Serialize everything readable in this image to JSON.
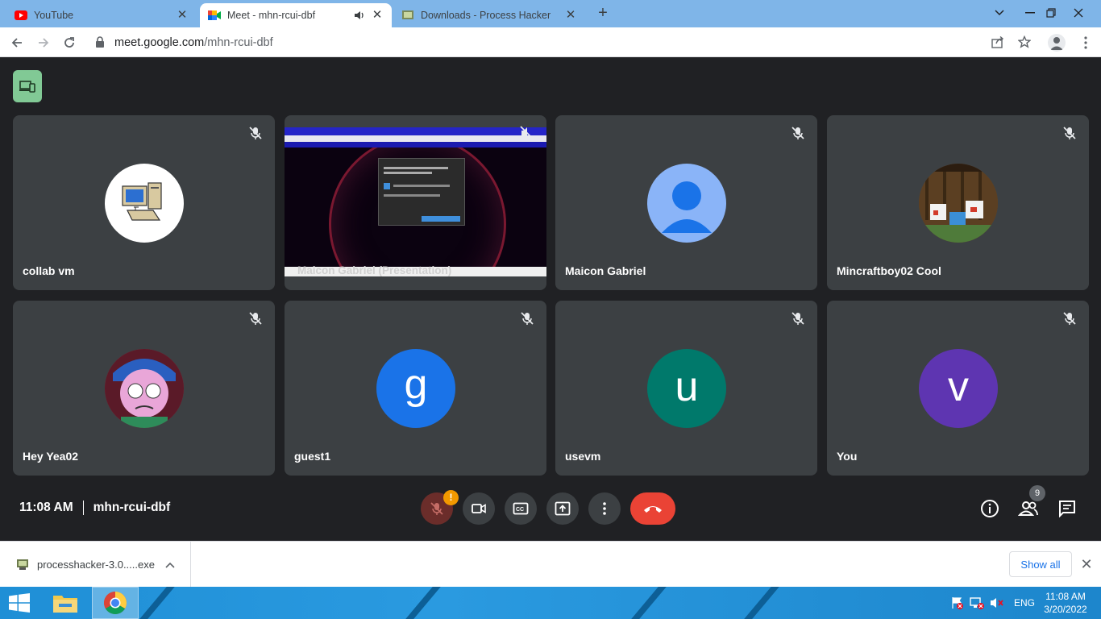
{
  "browser": {
    "tabs": [
      {
        "title": "YouTube",
        "active": false
      },
      {
        "title": "Meet - mhn-rcui-dbf",
        "active": true
      },
      {
        "title": "Downloads - Process Hacker",
        "active": false
      }
    ],
    "address": {
      "domain": "meet.google.com",
      "path": "/mhn-rcui-dbf"
    }
  },
  "meet": {
    "participants": [
      {
        "name": "collab vm",
        "avatar": "computer-avatar",
        "muted": true
      },
      {
        "name": "Maicon Gabriel (Presentation)",
        "avatar": "screen-share",
        "muted": true
      },
      {
        "name": "Maicon Gabriel",
        "avatar": "default-person",
        "color": "#8ab4f8",
        "muted": true
      },
      {
        "name": "Mincraftboy02 Cool",
        "avatar": "minecraft-photo",
        "muted": true
      },
      {
        "name": "Hey Yea02",
        "avatar": "cartoon-photo",
        "muted": true
      },
      {
        "name": "guest1",
        "avatar": "letter",
        "letter": "g",
        "color": "#1a73e8",
        "muted": true
      },
      {
        "name": "usevm",
        "avatar": "letter",
        "letter": "u",
        "color": "#00796b",
        "muted": true
      },
      {
        "name": "You",
        "avatar": "letter",
        "letter": "v",
        "color": "#5e35b1",
        "muted": true
      }
    ],
    "time": "11:08 AM",
    "meeting_code": "mhn-rcui-dbf",
    "mic_warning": "!",
    "people_count": "9"
  },
  "downloads": {
    "file": "processhacker-3.0.....exe",
    "show_all": "Show all"
  },
  "taskbar": {
    "time": "11:08 AM",
    "date": "3/20/2022",
    "lang": "ENG"
  }
}
